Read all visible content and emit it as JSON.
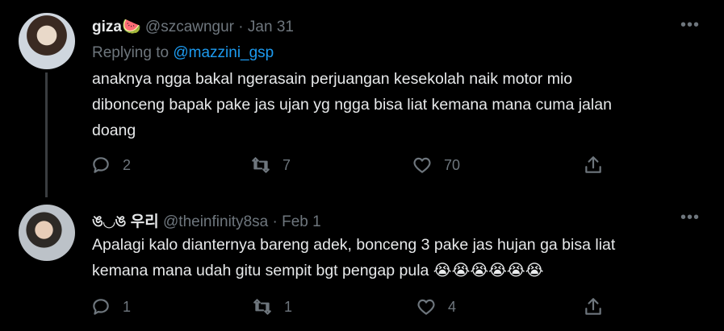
{
  "tweets": [
    {
      "display_name": "giza",
      "name_emoji": "🍉",
      "handle": "@szcawngur",
      "separator": "·",
      "date": "Jan 31",
      "replying_prefix": "Replying to",
      "replying_to": "@mazzini_gsp",
      "text_lines": [
        "anaknya ngga bakal ngerasain perjuangan kesekolah naik motor mio",
        "dibonceng bapak pake jas ujan yg ngga bisa liat kemana mana cuma jalan",
        "doang"
      ],
      "replies": "2",
      "retweets": "7",
      "likes": "70",
      "more": "•••"
    },
    {
      "display_name": "ঙ◡ঙ 우리",
      "handle": "@theinfinity8sa",
      "separator": "·",
      "date": "Feb 1",
      "text_lines": [
        "Apalagi kalo dianternya bareng adek, bonceng 3 pake jas hujan ga bisa liat",
        "kemana mana udah gitu sempit bgt pengap pula 😭😭😭😭😭😭"
      ],
      "replies": "1",
      "retweets": "1",
      "likes": "4",
      "more": "•••"
    }
  ],
  "icons": [
    "reply-icon",
    "retweet-icon",
    "like-icon",
    "share-icon",
    "more-icon"
  ],
  "colors": {
    "background": "#000000",
    "text": "#e7e9ea",
    "muted": "#6e767d",
    "mention": "#1d9bf0"
  }
}
